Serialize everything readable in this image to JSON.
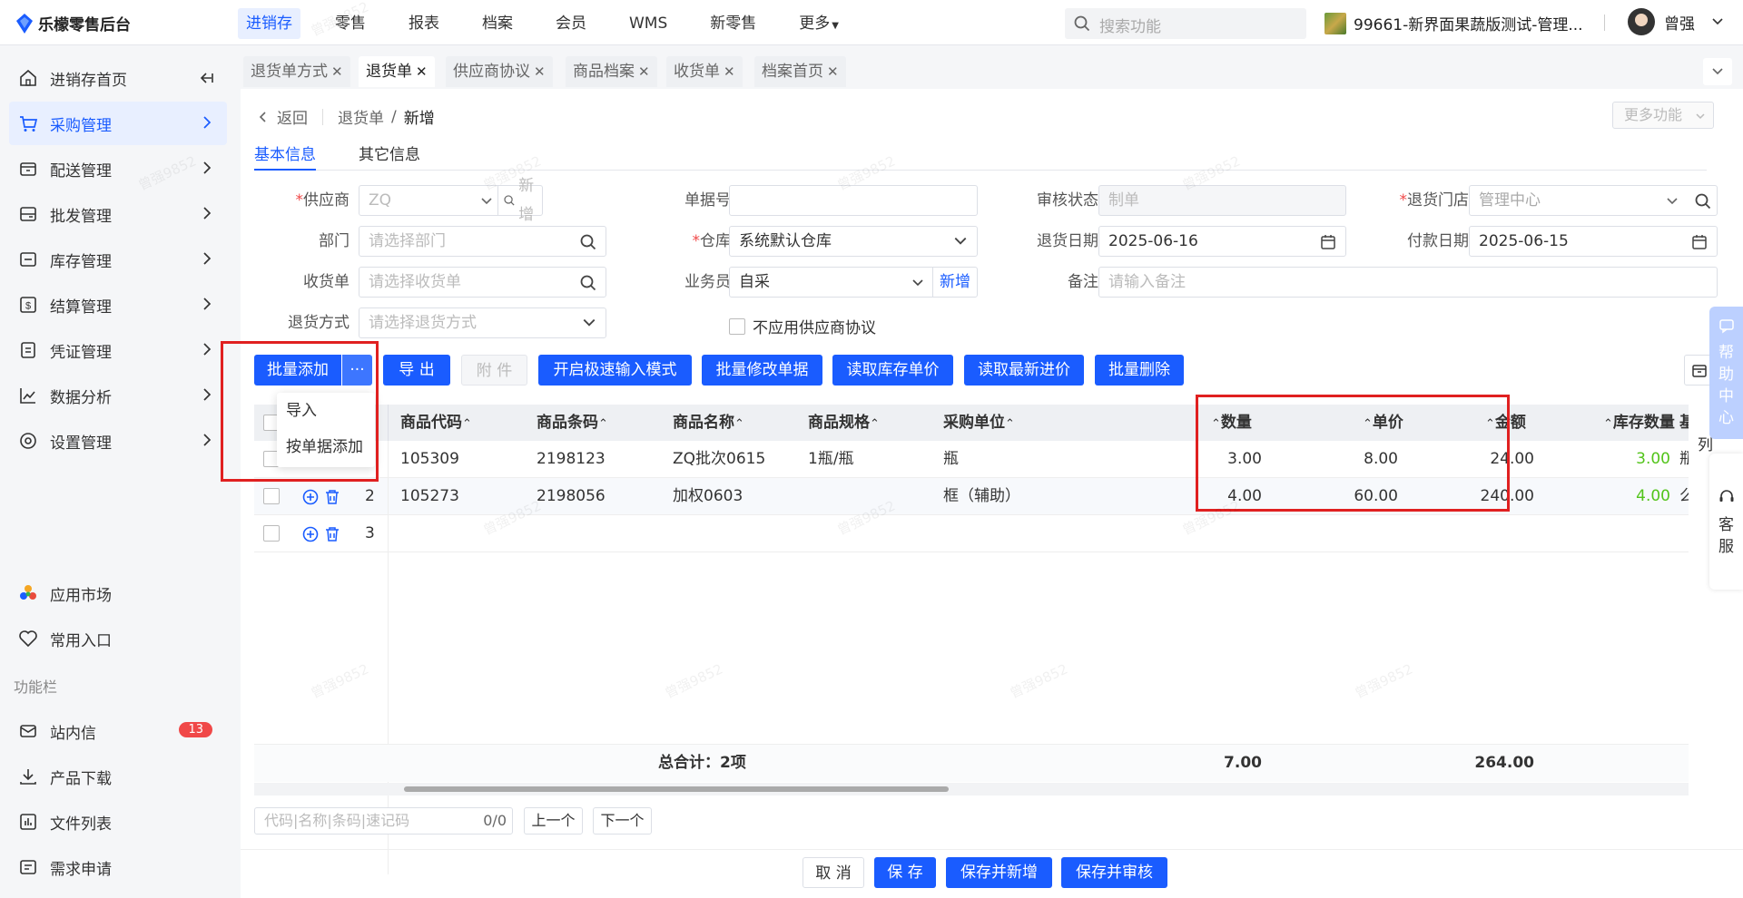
{
  "app": {
    "logo": "乐檬零售后台"
  },
  "topnav": [
    {
      "label": "进销存",
      "active": true
    },
    {
      "label": "零售"
    },
    {
      "label": "报表"
    },
    {
      "label": "档案"
    },
    {
      "label": "会员"
    },
    {
      "label": "WMS"
    },
    {
      "label": "新零售"
    },
    {
      "label": "更多"
    }
  ],
  "search": {
    "placeholder": "搜索功能"
  },
  "store": "99661-新界面果蔬版测试-管理...",
  "user": "曾强",
  "sidebar": {
    "items": [
      {
        "label": "进销存首页"
      },
      {
        "label": "采购管理",
        "active": true
      },
      {
        "label": "配送管理"
      },
      {
        "label": "批发管理"
      },
      {
        "label": "库存管理"
      },
      {
        "label": "结算管理"
      },
      {
        "label": "凭证管理"
      },
      {
        "label": "数据分析"
      },
      {
        "label": "设置管理"
      }
    ],
    "bottom": [
      {
        "label": "应用市场"
      },
      {
        "label": "常用入口"
      }
    ],
    "group_title": "功能栏",
    "tools": [
      {
        "label": "站内信",
        "badge": "13"
      },
      {
        "label": "产品下载"
      },
      {
        "label": "文件列表"
      },
      {
        "label": "需求申请"
      }
    ]
  },
  "tabs": [
    {
      "label": "退货单方式"
    },
    {
      "label": "退货单",
      "active": true
    },
    {
      "label": "供应商协议"
    },
    {
      "label": "商品档案"
    },
    {
      "label": "收货单"
    },
    {
      "label": "档案首页"
    }
  ],
  "breadcrumb": {
    "back": "返回",
    "parent": "退货单",
    "current": "新增"
  },
  "more_functions": "更多功能",
  "subtabs": [
    "基本信息",
    "其它信息"
  ],
  "form": {
    "supplier": {
      "label": "供应商",
      "value": "ZQ",
      "add": "新增"
    },
    "doc_no": {
      "label": "单据号",
      "value": ""
    },
    "audit": {
      "label": "审核状态",
      "placeholder": "制单"
    },
    "return_store": {
      "label": "退货门店",
      "value": "管理中心"
    },
    "dept": {
      "label": "部门",
      "placeholder": "请选择部门"
    },
    "warehouse": {
      "label": "仓库",
      "value": "系统默认仓库"
    },
    "return_date": {
      "label": "退货日期",
      "value": "2025-06-16"
    },
    "pay_date": {
      "label": "付款日期",
      "value": "2025-06-15"
    },
    "receipt": {
      "label": "收货单",
      "placeholder": "请选择收货单"
    },
    "salesman": {
      "label": "业务员",
      "value": "自采",
      "add": "新增"
    },
    "remark": {
      "label": "备注",
      "placeholder": "请输入备注"
    },
    "return_method": {
      "label": "退货方式",
      "placeholder": "请选择退货方式"
    },
    "no_protocol": "不应用供应商协议"
  },
  "toolbar": {
    "batch_add": "批量添加",
    "export": "导 出",
    "attach": "附 件",
    "fast_input": "开启极速输入模式",
    "batch_edit": "批量修改单据",
    "read_stock_price": "读取库存单价",
    "read_latest_price": "读取最新进价",
    "batch_delete": "批量删除"
  },
  "dropdown": [
    "导入",
    "按单据添加"
  ],
  "table": {
    "headers": [
      "序号",
      "商品代码",
      "商品条码",
      "商品名称",
      "商品规格",
      "采购单位",
      "数量",
      "单价",
      "金额",
      "库存数量",
      "基"
    ],
    "col_settings": "列",
    "rows": [
      {
        "no": "1",
        "code": "105309",
        "barcode": "2198123",
        "name": "ZQ批次0615",
        "spec": "1瓶/瓶",
        "unit": "瓶",
        "qty": "3.00",
        "price": "8.00",
        "amount": "24.00",
        "stock": "3.00",
        "base": "瓶"
      },
      {
        "no": "2",
        "code": "105273",
        "barcode": "2198056",
        "name": "加权0603",
        "spec": "",
        "unit": "框（辅助）",
        "qty": "4.00",
        "price": "60.00",
        "amount": "240.00",
        "stock": "4.00",
        "base": "么"
      },
      {
        "no": "3"
      }
    ],
    "footer": {
      "label": "总合计：2项",
      "qty": "7.00",
      "amount": "264.00"
    }
  },
  "find": {
    "placeholder": "代码|名称|条码|速记码",
    "count": "0/0",
    "prev": "上一个",
    "next": "下一个"
  },
  "bottom_buttons": {
    "cancel": "取 消",
    "save": "保 存",
    "save_new": "保存并新增",
    "save_audit": "保存并审核"
  },
  "float": {
    "help": "帮助中心",
    "service": "客服"
  },
  "watermark": "曾强9852"
}
